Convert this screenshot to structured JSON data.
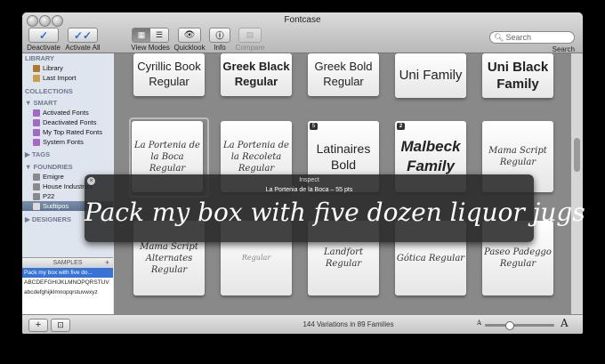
{
  "window": {
    "title": "Fontcase"
  },
  "toolbar": {
    "deactivate": "Deactivate",
    "activate_all": "Activate All",
    "view_modes": "View Modes",
    "quicklook": "Quicklook",
    "info": "Info",
    "compare": "Compare",
    "search_placeholder": "Search",
    "search_label": "Search"
  },
  "sidebar": {
    "library": "LIBRARY",
    "library_items": [
      "Library",
      "Last Import"
    ],
    "collections": "COLLECTIONS",
    "smart": "▼ SMART",
    "smart_items": [
      "Activated Fonts",
      "Deactivated Fonts",
      "My Top Rated Fonts",
      "System Fonts"
    ],
    "tags": "▶ TAGS",
    "foundries": "▼ FOUNDRIES",
    "foundry_items": [
      "Emigre",
      "House Industries",
      "P22",
      "Sudtipos"
    ],
    "designers": "▶ DESIGNERS"
  },
  "samples": {
    "label": "SAMPLES",
    "items": [
      "Pack my box with five do...",
      "ABCDEFGHIJKLMNOPQRSTUV",
      "abcdefghijklmnopqrstuvwxyz"
    ]
  },
  "cards": {
    "r1": [
      "Cyrillic Book Regular",
      "Greek Black Regular",
      "Greek Bold Regular",
      "Uni Family",
      "Uni Black Family"
    ],
    "r2": [
      "La Portenia de la Boca Regular",
      "La Portenia de la Recoleta Regular",
      "Latinaires Bold",
      "Malbeck Family",
      "Mama Script Regular"
    ],
    "r3": [
      "Mama Script Alternates Regular",
      "Regular",
      "Landfort Regular",
      "Gótica Regular",
      "Paseo Padeggo Regular"
    ],
    "badges": [
      "5",
      "2"
    ]
  },
  "inspect": {
    "title": "Inspect",
    "subtitle": "La Portenia de la Boca – 55 pts",
    "sample": "Pack my box with five dozen liquor jugs"
  },
  "status": {
    "text": "144 Variations in 89 Families",
    "zoom": 0.35,
    "a": "A"
  },
  "colors": {
    "selection": "#3874d8",
    "sidebar": "#dfe5ee",
    "grid_bg": "#898989"
  }
}
